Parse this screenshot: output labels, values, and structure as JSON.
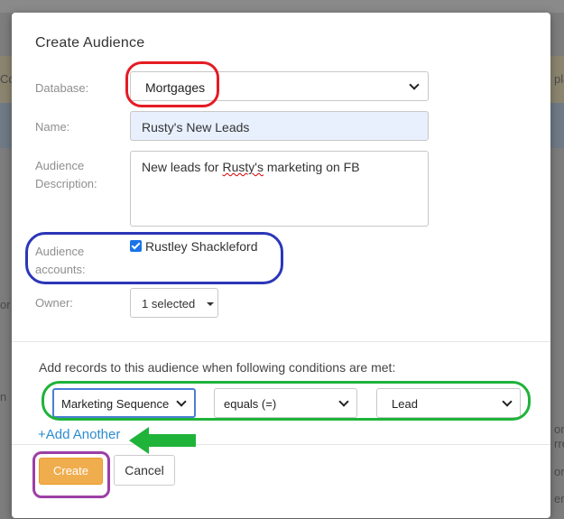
{
  "background": {
    "left_fragments": [
      "Co",
      "or",
      "n"
    ],
    "right_fragments": [
      "pla",
      "ord",
      "rre",
      "ord",
      "ent"
    ]
  },
  "dialog": {
    "title": "Create Audience",
    "database": {
      "label": "Database:",
      "value": "Mortgages"
    },
    "name": {
      "label": "Name:",
      "value": "Rusty's New Leads"
    },
    "description": {
      "label_line1": "Audience",
      "label_line2": "Description:",
      "value_prefix": "New leads for ",
      "value_misspelled": "Rusty's",
      "value_suffix": " marketing on FB"
    },
    "accounts": {
      "label_line1": "Audience",
      "label_line2": "accounts:",
      "option": "Rustley Shackleford",
      "checked": true
    },
    "owner": {
      "label": "Owner:",
      "value": "1 selected"
    },
    "conditions": {
      "intro": "Add records to this audience when following conditions are met:",
      "field": "Marketing Sequence",
      "operator": "equals (=)",
      "value": "Lead",
      "add_another": "+Add Another"
    },
    "buttons": {
      "create": "Create",
      "cancel": "Cancel"
    }
  },
  "colors": {
    "create_button": "#f0ad4e",
    "link": "#2d8ccf",
    "annotation_red": "#e51b23",
    "annotation_blue": "#2b36b8",
    "annotation_green": "#1fb33a",
    "annotation_purple": "#9c3fa6"
  }
}
